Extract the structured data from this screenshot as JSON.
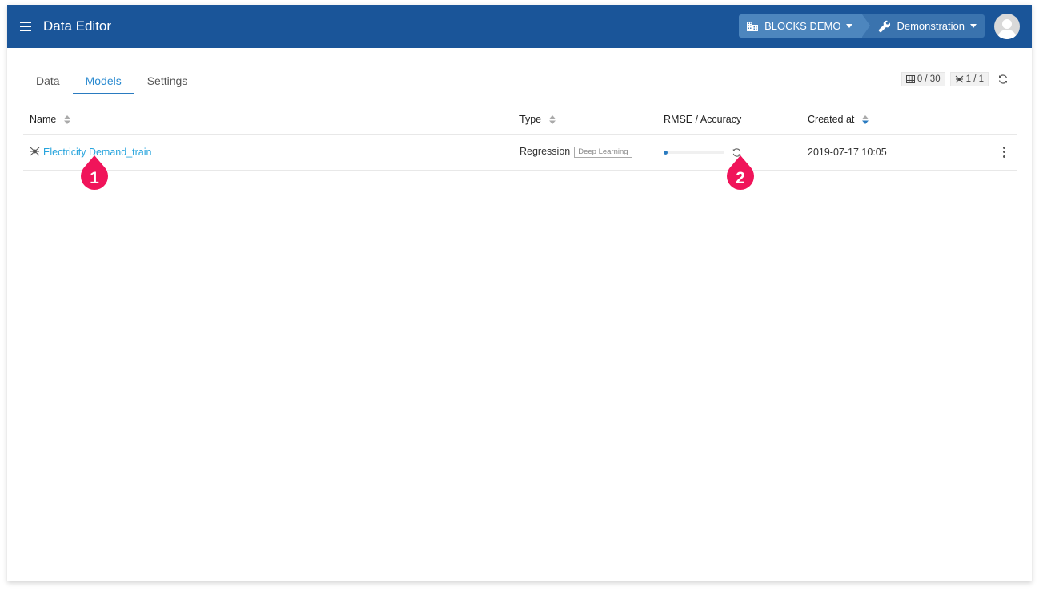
{
  "header": {
    "app_title": "Data Editor",
    "organization": "BLOCKS DEMO",
    "project": "Demonstration",
    "icons": {
      "menu": "hamburger-icon",
      "organization": "building-icon",
      "project": "wrench-icon",
      "avatar": "user-avatar-icon"
    },
    "colors": {
      "bar": "#1a5599",
      "org_crumb": "#4d86be",
      "project_crumb": "#3a73ae"
    }
  },
  "tabs": [
    {
      "label": "Data",
      "active": false
    },
    {
      "label": "Models",
      "active": true
    },
    {
      "label": "Settings",
      "active": false
    }
  ],
  "counters": {
    "datasets": "0 / 30",
    "models": "1 / 1",
    "icons": {
      "datasets": "table-icon",
      "models": "network-icon",
      "refresh": "refresh-icon"
    }
  },
  "table": {
    "columns": [
      {
        "label": "Name",
        "sortable": true
      },
      {
        "label": "Type",
        "sortable": true
      },
      {
        "label": "RMSE / Accuracy",
        "sortable": false
      },
      {
        "label": "Created at",
        "sortable": true,
        "sorted": "desc"
      }
    ],
    "rows": [
      {
        "name": "Electricity Demand_train",
        "type": "Regression",
        "badge": "Deep Learning",
        "progress": 0.05,
        "created_at": "2019-07-17 10:05"
      }
    ]
  },
  "annotations": [
    {
      "number": "1",
      "color": "#f0145a"
    },
    {
      "number": "2",
      "color": "#f0145a"
    }
  ],
  "colors": {
    "accent": "#2a7bc0",
    "link": "#26a4dd",
    "marker": "#f0145a"
  }
}
